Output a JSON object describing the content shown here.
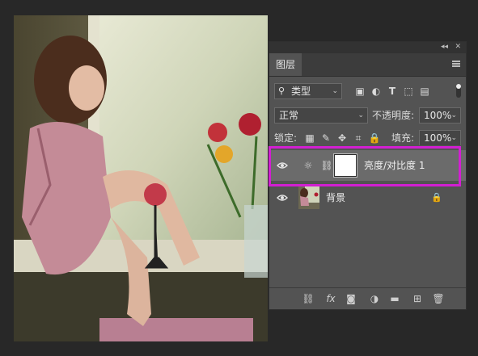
{
  "window": {
    "collapse_label": "◂◂",
    "close_label": "✕"
  },
  "panel": {
    "tab_label": "图层"
  },
  "filter": {
    "kind_label": "类型"
  },
  "blend": {
    "mode_value": "正常",
    "opacity_label": "不透明度:",
    "opacity_value": "100%"
  },
  "lock": {
    "label": "锁定:",
    "fill_label": "填充:",
    "fill_value": "100%"
  },
  "layers": [
    {
      "name": "亮度/对比度 1",
      "type": "adjustment",
      "selected": true,
      "visible": true
    },
    {
      "name": "背景",
      "type": "background",
      "selected": false,
      "visible": true,
      "locked": true
    }
  ],
  "bottom_icons": [
    "link-icon",
    "fx-icon",
    "mask-icon",
    "adjustment-icon",
    "folder-icon",
    "new-layer-icon",
    "trash-icon"
  ],
  "bottom": {
    "fx_label": "fx"
  },
  "colors": {
    "panel_bg": "#535353",
    "selected_row": "#6b6b6b",
    "highlight": "#d21fd2",
    "canvas_bg": "#282828"
  }
}
